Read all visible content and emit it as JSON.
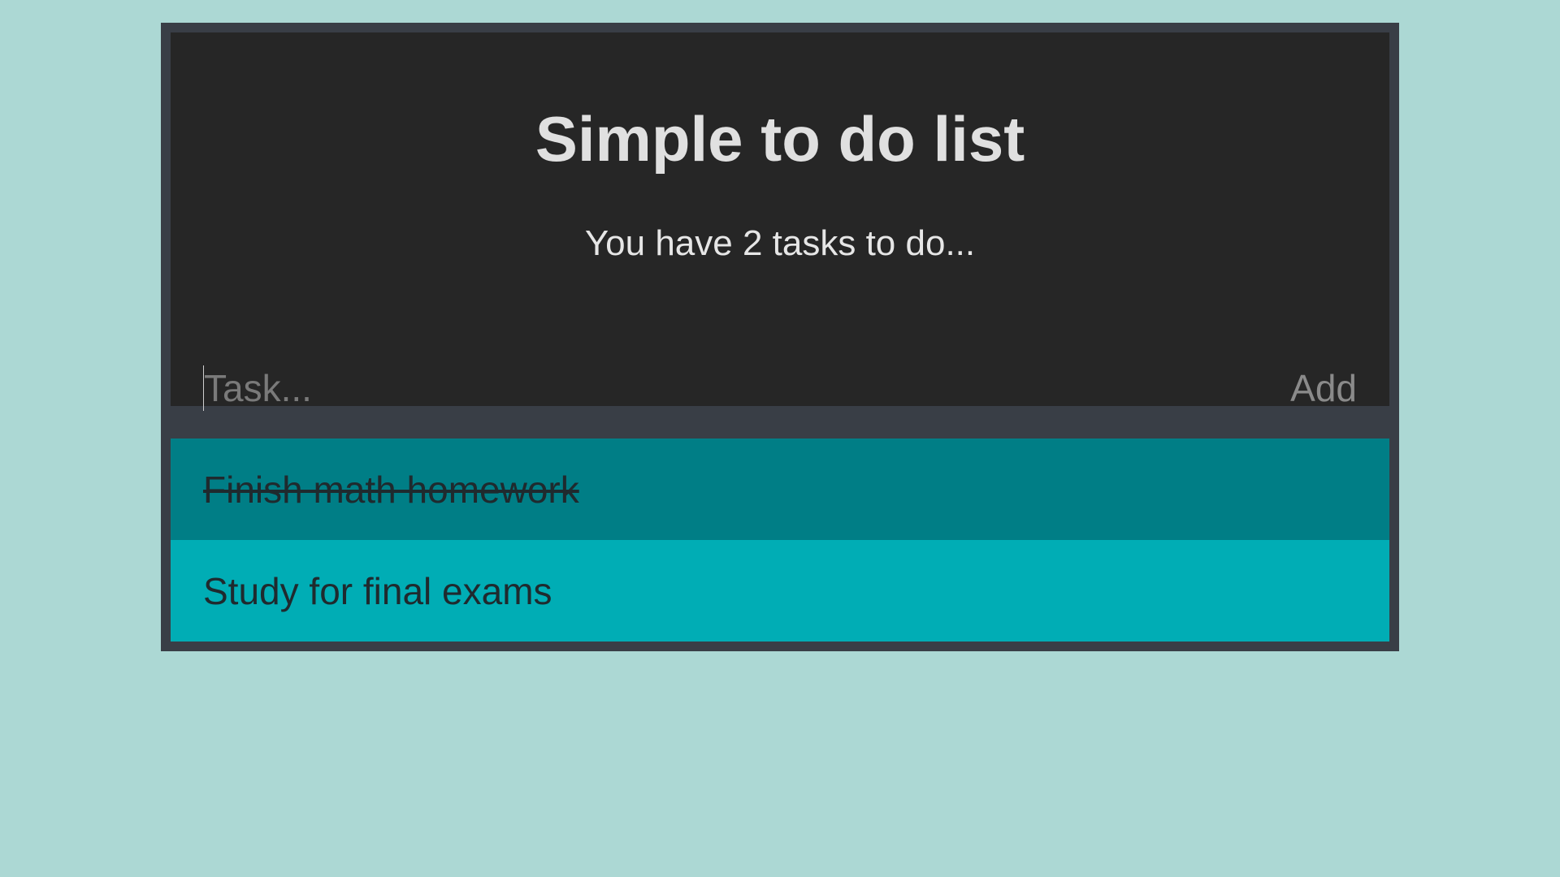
{
  "app": {
    "title": "Simple to do list",
    "task_count_text": "You have 2 tasks to do..."
  },
  "form": {
    "placeholder": "Task...",
    "value": "",
    "add_label": "Add"
  },
  "tasks": [
    {
      "label": "Finish math homework",
      "done": true
    },
    {
      "label": "Study for final exams",
      "done": false
    }
  ],
  "colors": {
    "page_background": "#acd8d4",
    "frame": "#393e46",
    "header_background": "#262626",
    "task_done": "#007e86",
    "task_pending": "#00adb5"
  }
}
